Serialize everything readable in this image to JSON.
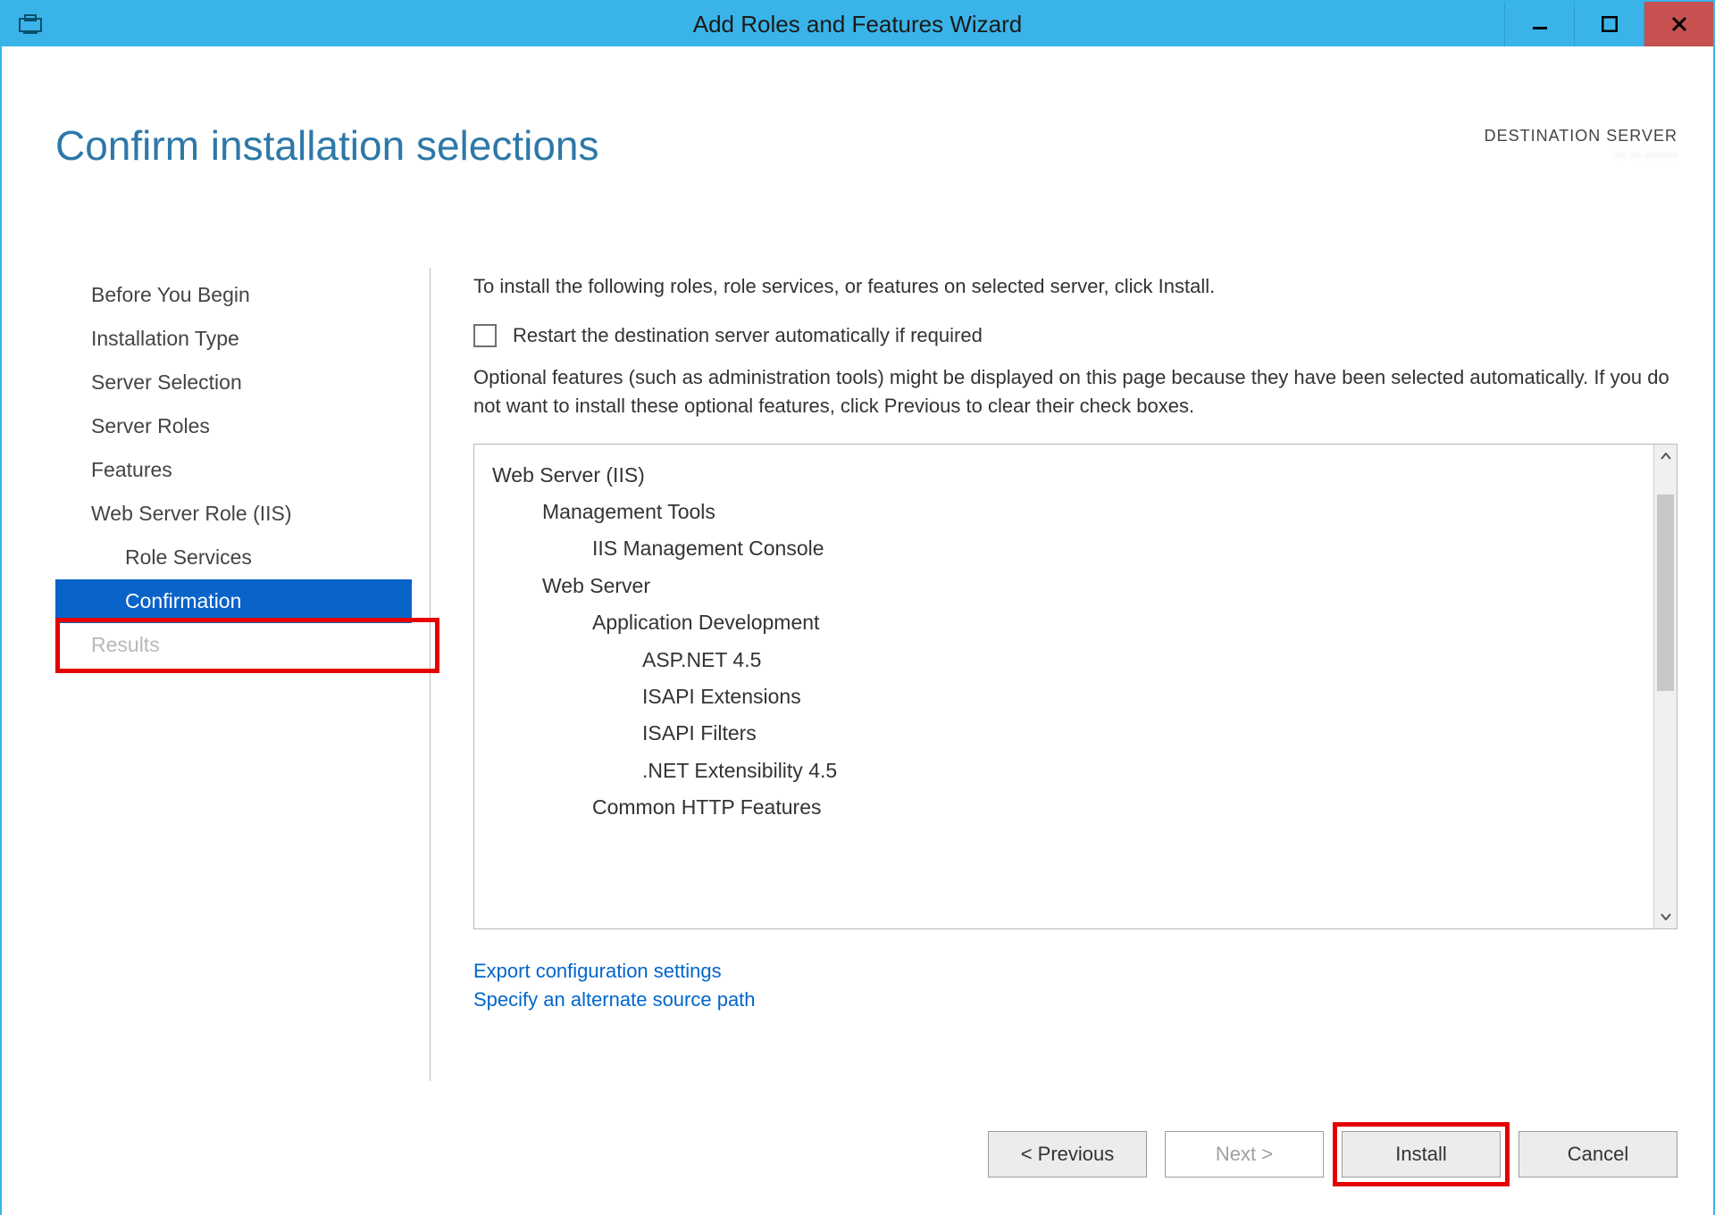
{
  "window": {
    "title": "Add Roles and Features Wizard"
  },
  "page": {
    "title": "Confirm installation selections",
    "destination_label": "DESTINATION SERVER",
    "destination_value": "·· ·· ······"
  },
  "sidebar": {
    "items": [
      {
        "label": "Before You Begin",
        "indent": false,
        "state": "normal"
      },
      {
        "label": "Installation Type",
        "indent": false,
        "state": "normal"
      },
      {
        "label": "Server Selection",
        "indent": false,
        "state": "normal"
      },
      {
        "label": "Server Roles",
        "indent": false,
        "state": "normal"
      },
      {
        "label": "Features",
        "indent": false,
        "state": "normal"
      },
      {
        "label": "Web Server Role (IIS)",
        "indent": false,
        "state": "normal"
      },
      {
        "label": "Role Services",
        "indent": true,
        "state": "normal"
      },
      {
        "label": "Confirmation",
        "indent": true,
        "state": "selected"
      },
      {
        "label": "Results",
        "indent": false,
        "state": "disabled"
      }
    ]
  },
  "content": {
    "instruction": "To install the following roles, role services, or features on selected server, click Install.",
    "restart_checkbox_label": "Restart the destination server automatically if required",
    "optional_note": "Optional features (such as administration tools) might be displayed on this page because they have been selected automatically. If you do not want to install these optional features, click Previous to clear their check boxes.",
    "tree": [
      {
        "level": 0,
        "text": "Web Server (IIS)"
      },
      {
        "level": 1,
        "text": "Management Tools"
      },
      {
        "level": 2,
        "text": "IIS Management Console"
      },
      {
        "level": 1,
        "text": "Web Server"
      },
      {
        "level": 2,
        "text": "Application Development"
      },
      {
        "level": 3,
        "text": "ASP.NET 4.5"
      },
      {
        "level": 3,
        "text": "ISAPI Extensions"
      },
      {
        "level": 3,
        "text": "ISAPI Filters"
      },
      {
        "level": 3,
        "text": ".NET Extensibility 4.5"
      },
      {
        "level": 2,
        "text": "Common HTTP Features"
      }
    ],
    "links": {
      "export": "Export configuration settings",
      "alt_source": "Specify an alternate source path"
    }
  },
  "buttons": {
    "previous": "< Previous",
    "next": "Next >",
    "install": "Install",
    "cancel": "Cancel"
  }
}
